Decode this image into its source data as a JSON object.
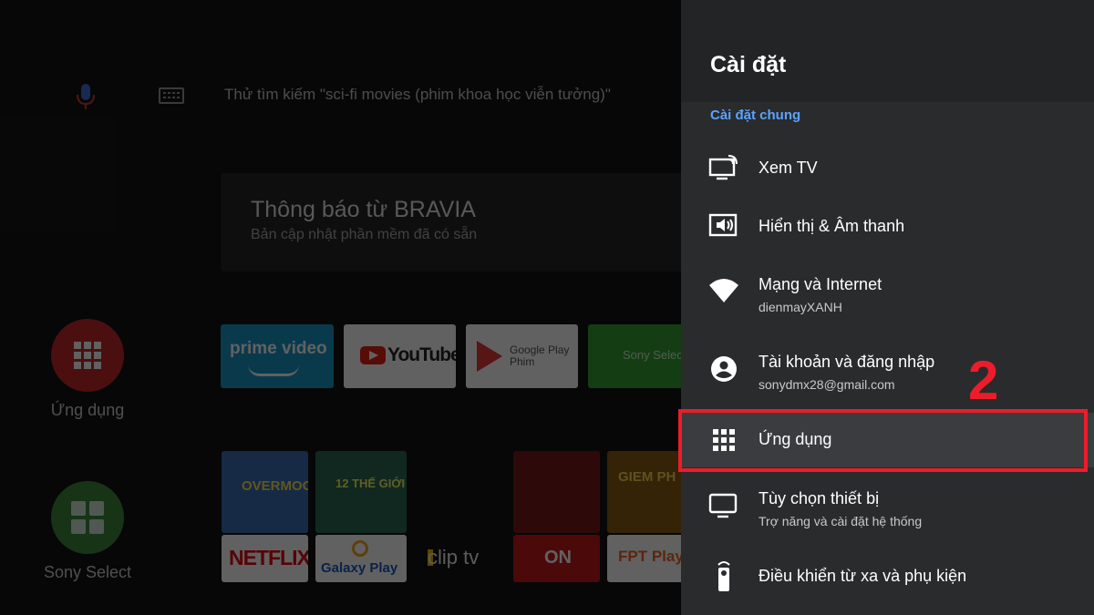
{
  "home": {
    "search_hint": "Thử tìm kiếm \"sci-fi movies (phim khoa học viễn tưởng)\"",
    "notification": {
      "title": "Thông báo từ BRAVIA",
      "subtitle": "Bản cập nhật phần mềm đã có sẵn"
    },
    "sidebar": [
      {
        "label": "Ứng dụng",
        "icon": "apps-grid-icon",
        "color": "#c62828"
      },
      {
        "label": "Sony Select",
        "icon": "sony-select-icon",
        "color": "#3d8a3d"
      }
    ],
    "app_row": [
      {
        "name": "prime video",
        "color": "#1a98c9"
      },
      {
        "name": "YouTube",
        "color": "#ffffff"
      },
      {
        "name": "Google Play",
        "sub": "Phim",
        "color": "#ffffff"
      },
      {
        "name": "Sony Select",
        "color": "#35a035"
      }
    ],
    "posters": [
      {
        "text": "OVERMOON"
      },
      {
        "text": "12 THẾ GIỚI"
      },
      {
        "text": ""
      },
      {
        "text": "GIEM PH"
      }
    ],
    "app_row_2": [
      "NETFLIX",
      "Galaxy Play",
      "clip tv",
      "ON",
      "FPT Play"
    ]
  },
  "settings": {
    "title": "Cài đặt",
    "section": "Cài đặt chung",
    "items": [
      {
        "label": "Xem TV",
        "sub": "",
        "icon": "tv-cast-icon"
      },
      {
        "label": "Hiển thị & Âm thanh",
        "sub": "",
        "icon": "display-sound-icon"
      },
      {
        "label": "Mạng và Internet",
        "sub": "dienmayXANH",
        "icon": "wifi-icon"
      },
      {
        "label": "Tài khoản và đăng nhập",
        "sub": "sonydmx28@gmail.com",
        "icon": "account-icon"
      },
      {
        "label": "Ứng dụng",
        "sub": "",
        "icon": "apps-grid-icon"
      },
      {
        "label": "Tùy chọn thiết bị",
        "sub": "Trợ năng và cài đặt hệ thống",
        "icon": "device-monitor-icon"
      },
      {
        "label": "Điều khiển từ xa và phụ kiện",
        "sub": "",
        "icon": "remote-icon"
      }
    ]
  },
  "annotation": {
    "step": "2",
    "color": "#ed1c2a"
  }
}
